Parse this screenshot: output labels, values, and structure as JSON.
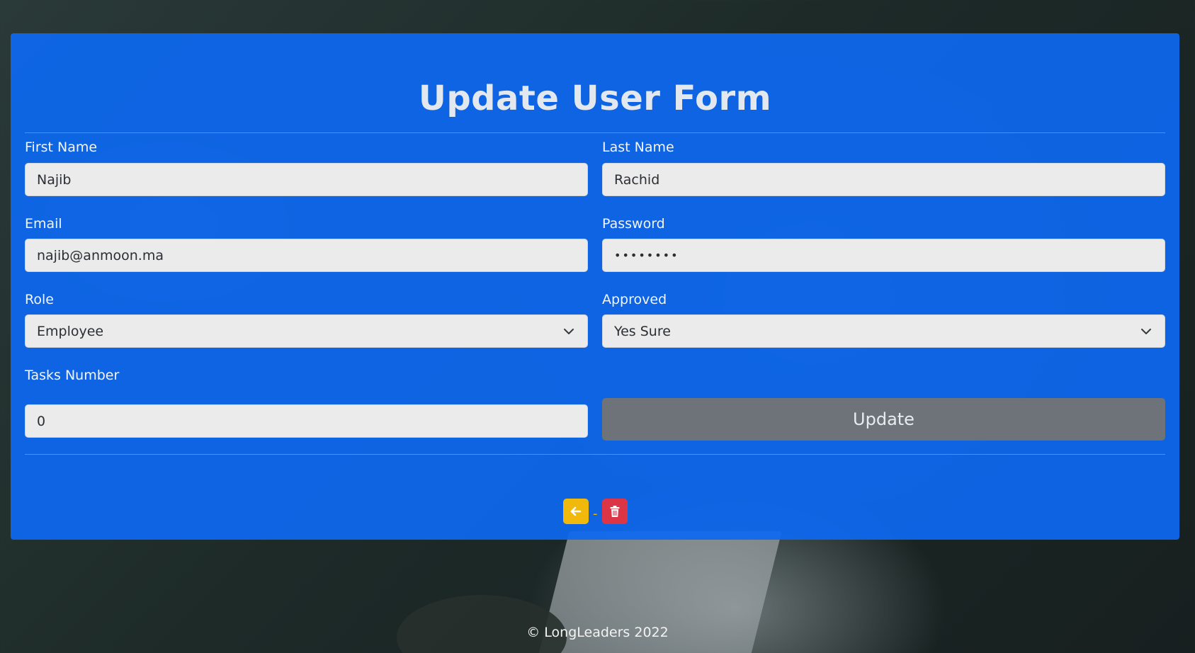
{
  "form": {
    "title": "Update User Form",
    "fields": {
      "first_name": {
        "label": "First Name",
        "value": "Najib"
      },
      "last_name": {
        "label": "Last Name",
        "value": "Rachid"
      },
      "email": {
        "label": "Email",
        "value": "najib@anmoon.ma"
      },
      "password": {
        "label": "Password",
        "value": "••••••••"
      },
      "role": {
        "label": "Role",
        "value": "Employee"
      },
      "approved": {
        "label": "Approved",
        "value": "Yes Sure"
      },
      "tasks_number": {
        "label": "Tasks Number",
        "value": "0"
      }
    },
    "update_label": "Update",
    "separator": "-"
  },
  "icons": {
    "back": "arrow-left-icon",
    "delete": "trash-icon",
    "select": "chevron-down-icon"
  },
  "colors": {
    "card": "#0d68f0",
    "update_button": "#6e7379",
    "back_button": "#f0b90b",
    "delete_button": "#dc3545"
  },
  "footer": {
    "text": "© LongLeaders 2022"
  }
}
